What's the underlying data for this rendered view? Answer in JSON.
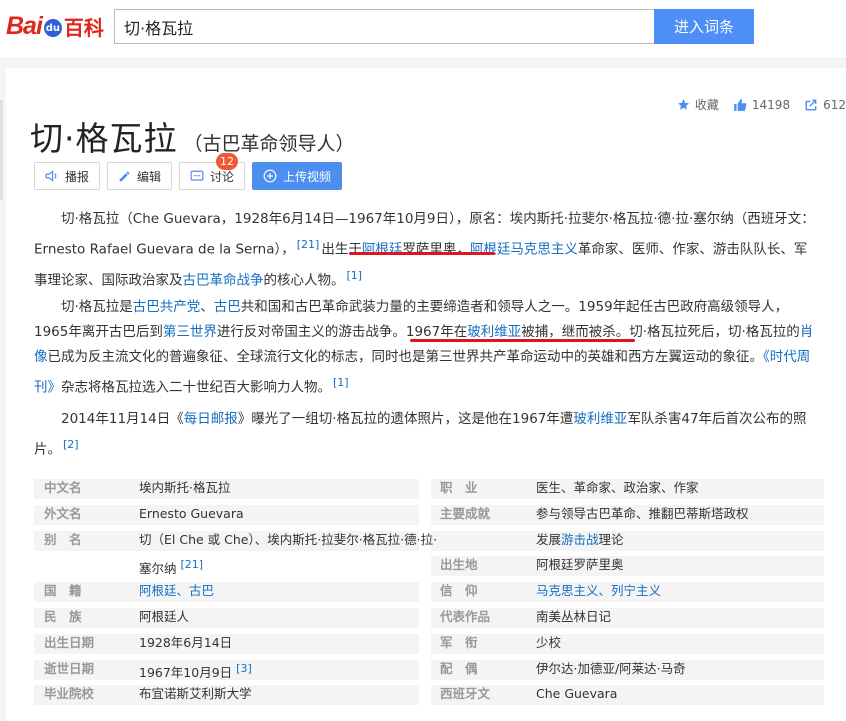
{
  "header": {
    "logo_bai": "Bai",
    "logo_du": "du",
    "logo_baike": "百科",
    "search_value": "切·格瓦拉",
    "search_button": "进入词条"
  },
  "stats": {
    "collect": "收藏",
    "likes": "14198",
    "shares": "612"
  },
  "title": "切·格瓦拉",
  "subtitle": "（古巴革命领导人）",
  "actions": {
    "report": "播报",
    "edit": "编辑",
    "discuss": "讨论",
    "discuss_count": "12",
    "upload": "上传视频"
  },
  "p1": {
    "a": "切·格瓦拉（Che Guevara，1928年6月14日—1967年10月9日），原名：埃内斯托·拉斐尔·格瓦拉·德·拉·塞尔纳（西班牙文：Ernesto Rafael Guevara de la Serna），",
    "ref1": "[21]",
    "b": "出生于",
    "link1": "阿根廷",
    "c": "罗萨里奥，",
    "link2": "阿根廷马克思主义",
    "d": "革命家、医师、作家、游击队队长、军事理论家、国际政治家及",
    "link3": "古巴革命战争",
    "e": "的核心人物。",
    "ref2": "[1]"
  },
  "p2": {
    "a": "切·格瓦拉是",
    "link1": "古巴共产党",
    "b": "、",
    "link2": "古巴",
    "c": "共和国和古巴革命武装力量的主要缔造者和领导人之一。1959年起任古巴政府高级领导人，1965年离开古巴后到",
    "link3": "第三世界",
    "d": "进行反对帝国主义的游击战争。",
    "e": "1967年在",
    "link4": "玻利维亚",
    "f": "被捕，继而被杀。",
    "g": "切·格瓦拉死后，切·格瓦拉的",
    "link5": "肖像",
    "h": "已成为反主流文化的普遍象征、全球流行文化的标志，同时也是第三世界共产革命运动中的英雄和西方左翼运动的象征。",
    "link6": "《时代周刊》",
    "i": "杂志将格瓦拉选入二十世纪百大影响力人物。",
    "ref1": "[1]"
  },
  "p3": {
    "a": "2014年11月14日《",
    "link1": "每日邮报",
    "b": "》曝光了一组切·格瓦拉的遗体照片，这是他在1967年遭",
    "link2": "玻利维亚",
    "c": "军队杀害47年后首次公布的照片。",
    "ref1": "[2]"
  },
  "info": {
    "r0": {
      "l1": "中文名",
      "v1": "埃内斯托·格瓦拉",
      "l2": "职　业",
      "v2": "医生、革命家、政治家、作家"
    },
    "r1": {
      "l1": "外文名",
      "v1": "Ernesto Guevara",
      "l2": "主要成就",
      "v2": "参与领导古巴革命、推翻巴蒂斯塔政权"
    },
    "r2": {
      "l1": "别　名",
      "v1": "切（El Che 或 Che）、埃内斯托·拉斐尔·格瓦拉·德·拉·",
      "v2a": "发展",
      "v2link": "游击战",
      "v2b": "理论"
    },
    "r3": {
      "v1": "塞尔纳",
      "ref": "[21]",
      "l2": "出生地",
      "v2": "阿根廷罗萨里奥"
    },
    "r4": {
      "l1": "国　籍",
      "v1link1": "阿根廷",
      "v1sep": "、",
      "v1link2": "古巴",
      "l2": "信　仰",
      "v2link1": "马克思主义",
      "v2sep": "、",
      "v2link2": "列宁主义"
    },
    "r5": {
      "l1": "民　族",
      "v1": "阿根廷人",
      "l2": "代表作品",
      "v2link": "南美丛林日记"
    },
    "r6": {
      "l1": "出生日期",
      "v1": "1928年6月14日",
      "l2": "军　衔",
      "v2link": "少校"
    },
    "r7": {
      "l1": "逝世日期",
      "v1": "1967年10月9日",
      "ref": "[3]",
      "l2": "配　偶",
      "v2": "伊尔达·加德亚/阿莱达·马奇"
    },
    "r8": {
      "l1": "毕业院校",
      "v1link": "布宜诺斯艾利斯大学",
      "l2": "西班牙文",
      "v2": "Che Guevara"
    }
  },
  "colors": {
    "brand_red": "#e1251b",
    "link_blue": "#136ec2",
    "button_blue": "#4e8ef7",
    "annotation_red": "#e0141e"
  }
}
